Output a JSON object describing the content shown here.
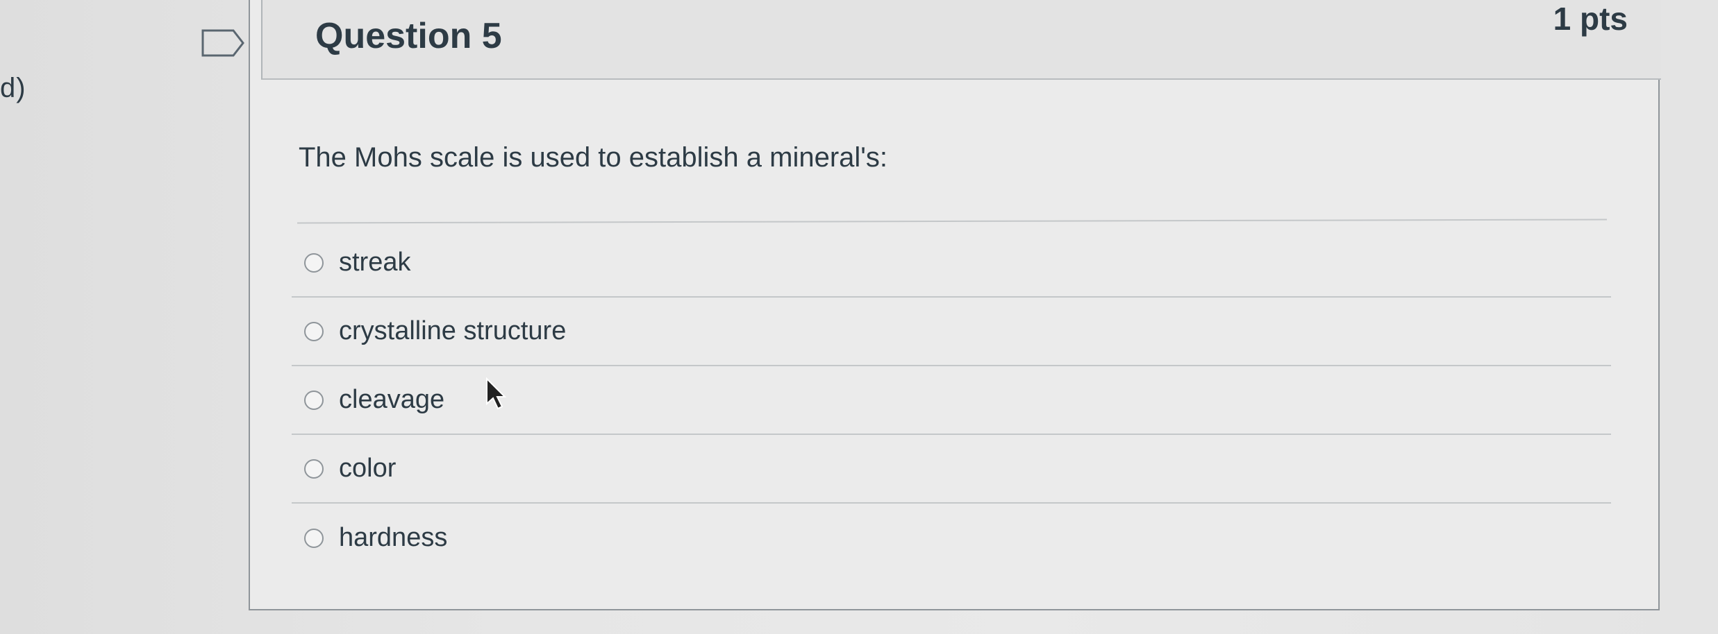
{
  "side_fragment": "d)",
  "question": {
    "title": "Question 5",
    "points": "1 pts",
    "text": "The Mohs scale is used to establish a mineral's:",
    "answers": [
      {
        "label": "streak"
      },
      {
        "label": "crystalline structure"
      },
      {
        "label": "cleavage"
      },
      {
        "label": "color"
      },
      {
        "label": "hardness"
      }
    ]
  },
  "icons": {
    "flag": "flag-icon",
    "cursor": "mouse-pointer-icon"
  }
}
